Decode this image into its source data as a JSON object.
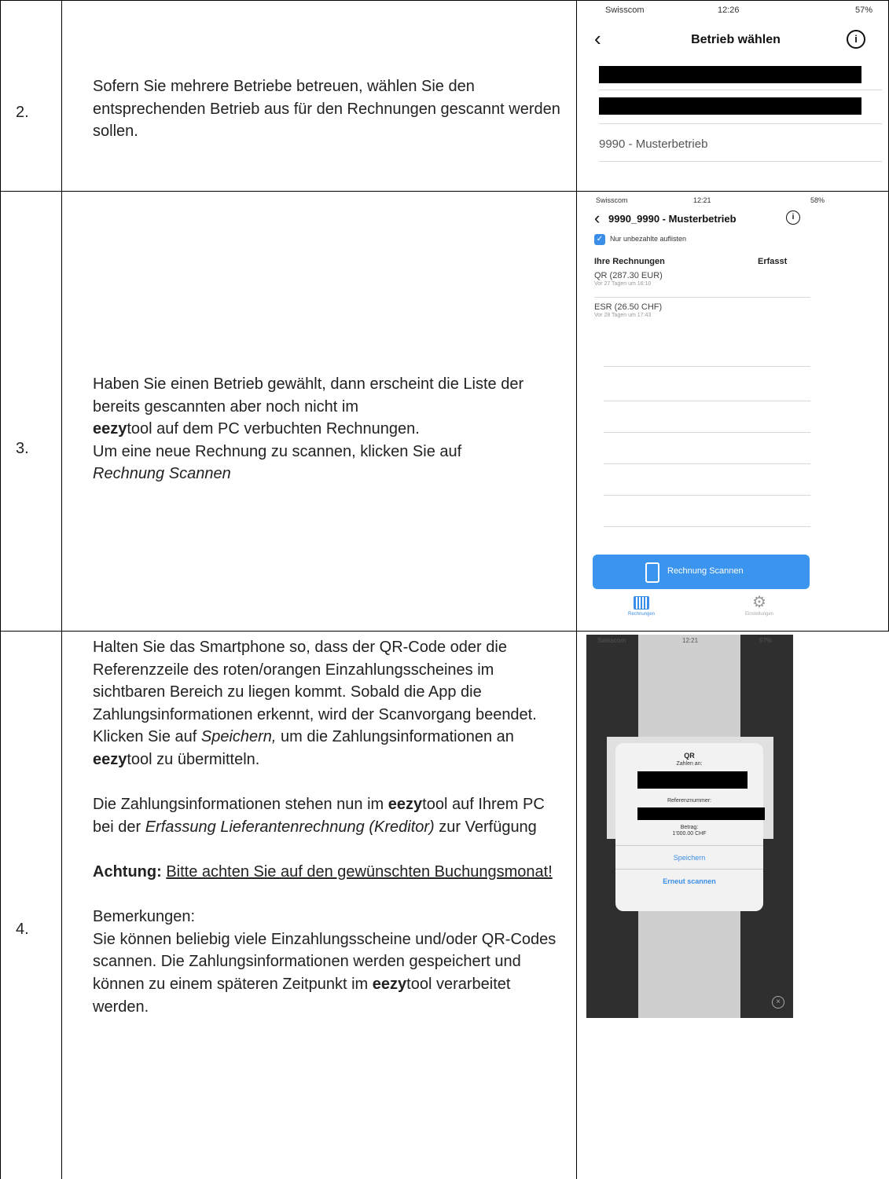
{
  "rows": [
    {
      "number": "2.",
      "text": "Sofern Sie mehrere Betriebe betreuen, wählen Sie den entsprechenden Betrieb aus für den Rechnungen gescannt werden sollen.",
      "screenshot": {
        "carrier": "Swisscom",
        "time": "12:26",
        "battery": "57%",
        "title": "Betrieb wählen",
        "list_item": "9990 - Musterbetrieb"
      }
    },
    {
      "number": "3.",
      "text_line1": "Haben Sie einen Betrieb gewählt, dann erscheint die Liste der bereits gescannten aber noch nicht im",
      "text_bold": "eezy",
      "text_line2": "tool auf dem PC verbuchten Rechnungen.",
      "text_line3": "Um eine neue Rechnung zu scannen, klicken Sie auf",
      "text_italic": "Rechnung Scannen",
      "screenshot": {
        "carrier": "Swisscom",
        "time": "12:21",
        "battery": "58%",
        "title": "9990_9990 - Musterbetrieb",
        "checkbox_label": "Nur unbezahlte auflisten",
        "col_left": "Ihre Rechnungen",
        "col_right": "Erfasst",
        "invoices": [
          {
            "title": "QR (287.30 EUR)",
            "sub": "Vor 27 Tagen um 16:10"
          },
          {
            "title": "ESR (26.50 CHF)",
            "sub": "Vor 28 Tagen um 17:43"
          }
        ],
        "scan_button": "Rechnung Scannen",
        "tab_left": "Rechnungen",
        "tab_right": "Einstellungen"
      }
    },
    {
      "number": "4.",
      "p1": "Halten Sie das Smartphone so, dass der QR-Code oder die Referenzzeile des roten/orangen Einzahlungsscheines im sichtbaren Bereich zu liegen kommt. Sobald die App die Zahlungsinformationen erkennt, wird der Scanvorgang beendet.",
      "p2_a": "Klicken Sie auf ",
      "p2_italic": "Speichern,",
      "p2_b": " um die Zahlungsinformationen an ",
      "p2_bold": "eezy",
      "p2_c": "tool zu übermitteln.",
      "p3_a": "Die Zahlungsinformationen stehen nun im ",
      "p3_bold": "eezy",
      "p3_b": "tool auf Ihrem PC bei der ",
      "p3_italic": "Erfassung Lieferantenrechnung (Kreditor)",
      "p3_c": " zur Verfügung",
      "p4_bold": "Achtung:",
      "p4_underline": "Bitte achten Sie auf den gewünschten Buchungsmonat!",
      "p5_title": "Bemerkungen:",
      "p5_a": "Sie können beliebig viele Einzahlungsscheine und/oder QR-Codes scannen. Die Zahlungsinformationen werden gespeichert und können zu einem späteren Zeitpunkt im ",
      "p5_bold": "eezy",
      "p5_b": "tool verarbeitet werden.",
      "screenshot": {
        "carrier": "Swisscom",
        "time": "12:21",
        "battery": "57%",
        "dialog_title": "QR",
        "pay_to_label": "Zahlen an:",
        "ref_label": "Referenznummer:",
        "amount_label": "Betrag:",
        "amount_value": "1'000.00 CHF",
        "save_button": "Speichern",
        "rescan_button": "Erneut scannen"
      }
    }
  ]
}
